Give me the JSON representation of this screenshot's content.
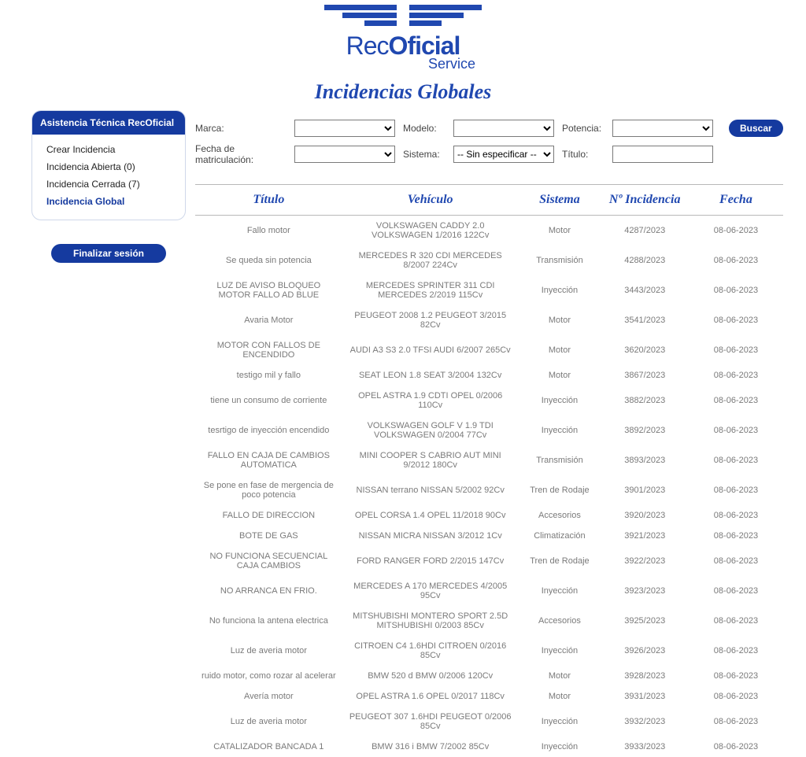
{
  "logo": {
    "text1": "Rec",
    "text2": "Oficial",
    "sub": "Service"
  },
  "page_title": "Incidencias Globales",
  "sidebar": {
    "title": "Asistencia Técnica RecOficial",
    "items": [
      {
        "label": "Crear Incidencia",
        "active": false
      },
      {
        "label": "Incidencia Abierta (0)",
        "active": false
      },
      {
        "label": "Incidencia Cerrada (7)",
        "active": false
      },
      {
        "label": "Incidencia Global",
        "active": true
      }
    ],
    "end_session": "Finalizar sesión"
  },
  "filters": {
    "marca_label": "Marca:",
    "modelo_label": "Modelo:",
    "potencia_label": "Potencia:",
    "fecha_label": "Fecha de matriculación:",
    "sistema_label": "Sistema:",
    "sistema_selected": "-- Sin especificar --",
    "titulo_label": "Título:",
    "search": "Buscar"
  },
  "headers": {
    "titulo": "Título",
    "vehiculo": "Vehículo",
    "sistema": "Sistema",
    "incidencia": "Nº Incidencia",
    "fecha": "Fecha"
  },
  "rows": [
    {
      "titulo": "Fallo motor",
      "vehiculo": "VOLKSWAGEN CADDY 2.0 VOLKSWAGEN 1/2016 122Cv",
      "sistema": "Motor",
      "num": "4287/2023",
      "fecha": "08-06-2023"
    },
    {
      "titulo": "Se queda sin potencia",
      "vehiculo": "MERCEDES R 320 CDI MERCEDES 8/2007 224Cv",
      "sistema": "Transmisión",
      "num": "4288/2023",
      "fecha": "08-06-2023"
    },
    {
      "titulo": "LUZ DE AVISO BLOQUEO MOTOR FALLO AD BLUE",
      "vehiculo": "MERCEDES SPRINTER 311 CDI MERCEDES 2/2019 115Cv",
      "sistema": "Inyección",
      "num": "3443/2023",
      "fecha": "08-06-2023"
    },
    {
      "titulo": "Avaria Motor",
      "vehiculo": "PEUGEOT 2008 1.2 PEUGEOT 3/2015 82Cv",
      "sistema": "Motor",
      "num": "3541/2023",
      "fecha": "08-06-2023"
    },
    {
      "titulo": "MOTOR CON FALLOS DE ENCENDIDO",
      "vehiculo": "AUDI A3 S3 2.0 TFSI AUDI 6/2007 265Cv",
      "sistema": "Motor",
      "num": "3620/2023",
      "fecha": "08-06-2023"
    },
    {
      "titulo": "testigo mil y fallo",
      "vehiculo": "SEAT LEON 1.8 SEAT 3/2004 132Cv",
      "sistema": "Motor",
      "num": "3867/2023",
      "fecha": "08-06-2023"
    },
    {
      "titulo": "tiene un consumo de corriente",
      "vehiculo": "OPEL ASTRA 1.9 CDTI OPEL 0/2006 110Cv",
      "sistema": "Inyección",
      "num": "3882/2023",
      "fecha": "08-06-2023"
    },
    {
      "titulo": "tesrtigo de inyección encendido",
      "vehiculo": "VOLKSWAGEN GOLF V 1.9 TDI VOLKSWAGEN 0/2004 77Cv",
      "sistema": "Inyección",
      "num": "3892/2023",
      "fecha": "08-06-2023"
    },
    {
      "titulo": "FALLO EN CAJA DE CAMBIOS AUTOMATICA",
      "vehiculo": "MINI COOPER S CABRIO AUT MINI 9/2012 180Cv",
      "sistema": "Transmisión",
      "num": "3893/2023",
      "fecha": "08-06-2023"
    },
    {
      "titulo": "Se pone en fase de mergencia de poco potencia",
      "vehiculo": "NISSAN terrano NISSAN 5/2002 92Cv",
      "sistema": "Tren de Rodaje",
      "num": "3901/2023",
      "fecha": "08-06-2023"
    },
    {
      "titulo": "FALLO DE DIRECCION",
      "vehiculo": "OPEL CORSA 1.4 OPEL 11/2018 90Cv",
      "sistema": "Accesorios",
      "num": "3920/2023",
      "fecha": "08-06-2023"
    },
    {
      "titulo": "BOTE DE GAS",
      "vehiculo": "NISSAN MICRA NISSAN 3/2012 1Cv",
      "sistema": "Climatización",
      "num": "3921/2023",
      "fecha": "08-06-2023"
    },
    {
      "titulo": "NO FUNCIONA SECUENCIAL CAJA CAMBIOS",
      "vehiculo": "FORD RANGER FORD 2/2015 147Cv",
      "sistema": "Tren de Rodaje",
      "num": "3922/2023",
      "fecha": "08-06-2023"
    },
    {
      "titulo": "NO ARRANCA EN FRIO.",
      "vehiculo": "MERCEDES A 170 MERCEDES 4/2005 95Cv",
      "sistema": "Inyección",
      "num": "3923/2023",
      "fecha": "08-06-2023"
    },
    {
      "titulo": "No funciona la antena electrica",
      "vehiculo": "MITSHUBISHI MONTERO SPORT 2.5D MITSHUBISHI 0/2003 85Cv",
      "sistema": "Accesorios",
      "num": "3925/2023",
      "fecha": "08-06-2023"
    },
    {
      "titulo": "Luz de averia motor",
      "vehiculo": "CITROEN C4 1.6HDI CITROEN 0/2016 85Cv",
      "sistema": "Inyección",
      "num": "3926/2023",
      "fecha": "08-06-2023"
    },
    {
      "titulo": "ruido motor, como rozar al acelerar",
      "vehiculo": "BMW 520 d BMW 0/2006 120Cv",
      "sistema": "Motor",
      "num": "3928/2023",
      "fecha": "08-06-2023"
    },
    {
      "titulo": "Avería motor",
      "vehiculo": "OPEL ASTRA 1.6 OPEL 0/2017 118Cv",
      "sistema": "Motor",
      "num": "3931/2023",
      "fecha": "08-06-2023"
    },
    {
      "titulo": "Luz de averia motor",
      "vehiculo": "PEUGEOT 307 1.6HDI PEUGEOT 0/2006 85Cv",
      "sistema": "Inyección",
      "num": "3932/2023",
      "fecha": "08-06-2023"
    },
    {
      "titulo": "CATALIZADOR BANCADA 1",
      "vehiculo": "BMW 316 i BMW 7/2002 85Cv",
      "sistema": "Inyección",
      "num": "3933/2023",
      "fecha": "08-06-2023"
    }
  ]
}
